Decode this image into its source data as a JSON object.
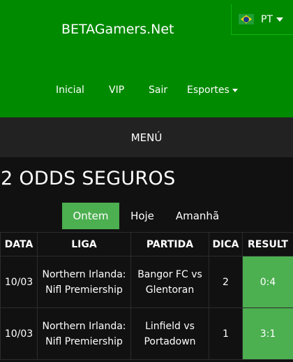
{
  "header": {
    "brand": "BETAGamers.Net",
    "language": {
      "label": "PT",
      "flag_icon": "brazil-flag-icon"
    },
    "nav": [
      {
        "label": "Inicial"
      },
      {
        "label": "VIP"
      },
      {
        "label": "Sair"
      },
      {
        "label": "Esportes"
      }
    ]
  },
  "menu": {
    "label": "MENÚ"
  },
  "page": {
    "title": "2 ODDS SEGUROS"
  },
  "tabs": [
    {
      "label": "Ontem",
      "active": true
    },
    {
      "label": "Hoje",
      "active": false
    },
    {
      "label": "Amanhã",
      "active": false
    }
  ],
  "table": {
    "headers": [
      "DATA",
      "LIGA",
      "PARTIDA",
      "DICA",
      "RESULT"
    ],
    "rows": [
      {
        "data": "10/03",
        "liga": "Northern Irlanda: Nifl Premiership",
        "partida": "Bangor FC vs Glentoran",
        "dica": "2",
        "result": "0:4"
      },
      {
        "data": "10/03",
        "liga": "Northern Irlanda: Nifl Premiership",
        "partida": "Linfield vs Portadown",
        "dica": "1",
        "result": "3:1"
      }
    ]
  },
  "colors": {
    "header_green": "#008a00",
    "result_green": "#4caf50",
    "background": "#111111",
    "menu_bar": "#222222"
  }
}
